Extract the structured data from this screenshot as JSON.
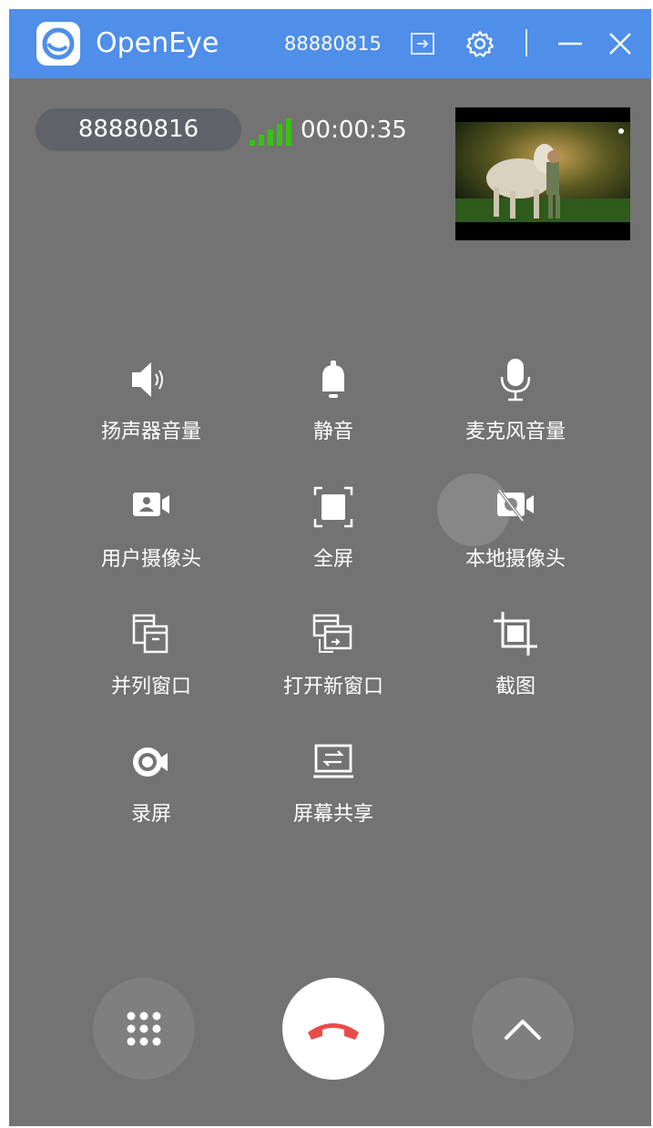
{
  "titlebar": {
    "app_name": "OpenEye",
    "user_id": "88880815",
    "icons": [
      "logout-icon",
      "settings-gear-icon",
      "separator",
      "minimize-icon",
      "close-icon"
    ]
  },
  "call": {
    "remote_id": "88880816",
    "duration": "00:00:35",
    "signal": "good",
    "colors": {
      "signal_active": "#39c016",
      "pill": "#5f6369",
      "hangup": "#e94b4b"
    }
  },
  "controls": [
    {
      "id": "speaker-volume",
      "label": "扬声器音量",
      "icon": "speaker-icon"
    },
    {
      "id": "mute",
      "label": "静音",
      "icon": "bell-icon"
    },
    {
      "id": "mic-volume",
      "label": "麦克风音量",
      "icon": "microphone-icon"
    },
    {
      "id": "user-camera",
      "label": "用户摄像头",
      "icon": "user-camera-icon"
    },
    {
      "id": "fullscreen",
      "label": "全屏",
      "icon": "fullscreen-icon"
    },
    {
      "id": "local-camera",
      "label": "本地摄像头",
      "icon": "camera-off-icon"
    },
    {
      "id": "side-by-side",
      "label": "并列窗口",
      "icon": "side-by-side-windows-icon"
    },
    {
      "id": "open-new-window",
      "label": "打开新窗口",
      "icon": "new-window-icon"
    },
    {
      "id": "screenshot",
      "label": "截图",
      "icon": "crop-icon"
    },
    {
      "id": "record-screen",
      "label": "录屏",
      "icon": "record-icon"
    },
    {
      "id": "screen-share",
      "label": "屏幕共享",
      "icon": "screen-share-icon"
    }
  ],
  "bottom_buttons": [
    "dialpad-icon",
    "hangup-icon",
    "chevron-up-icon"
  ]
}
